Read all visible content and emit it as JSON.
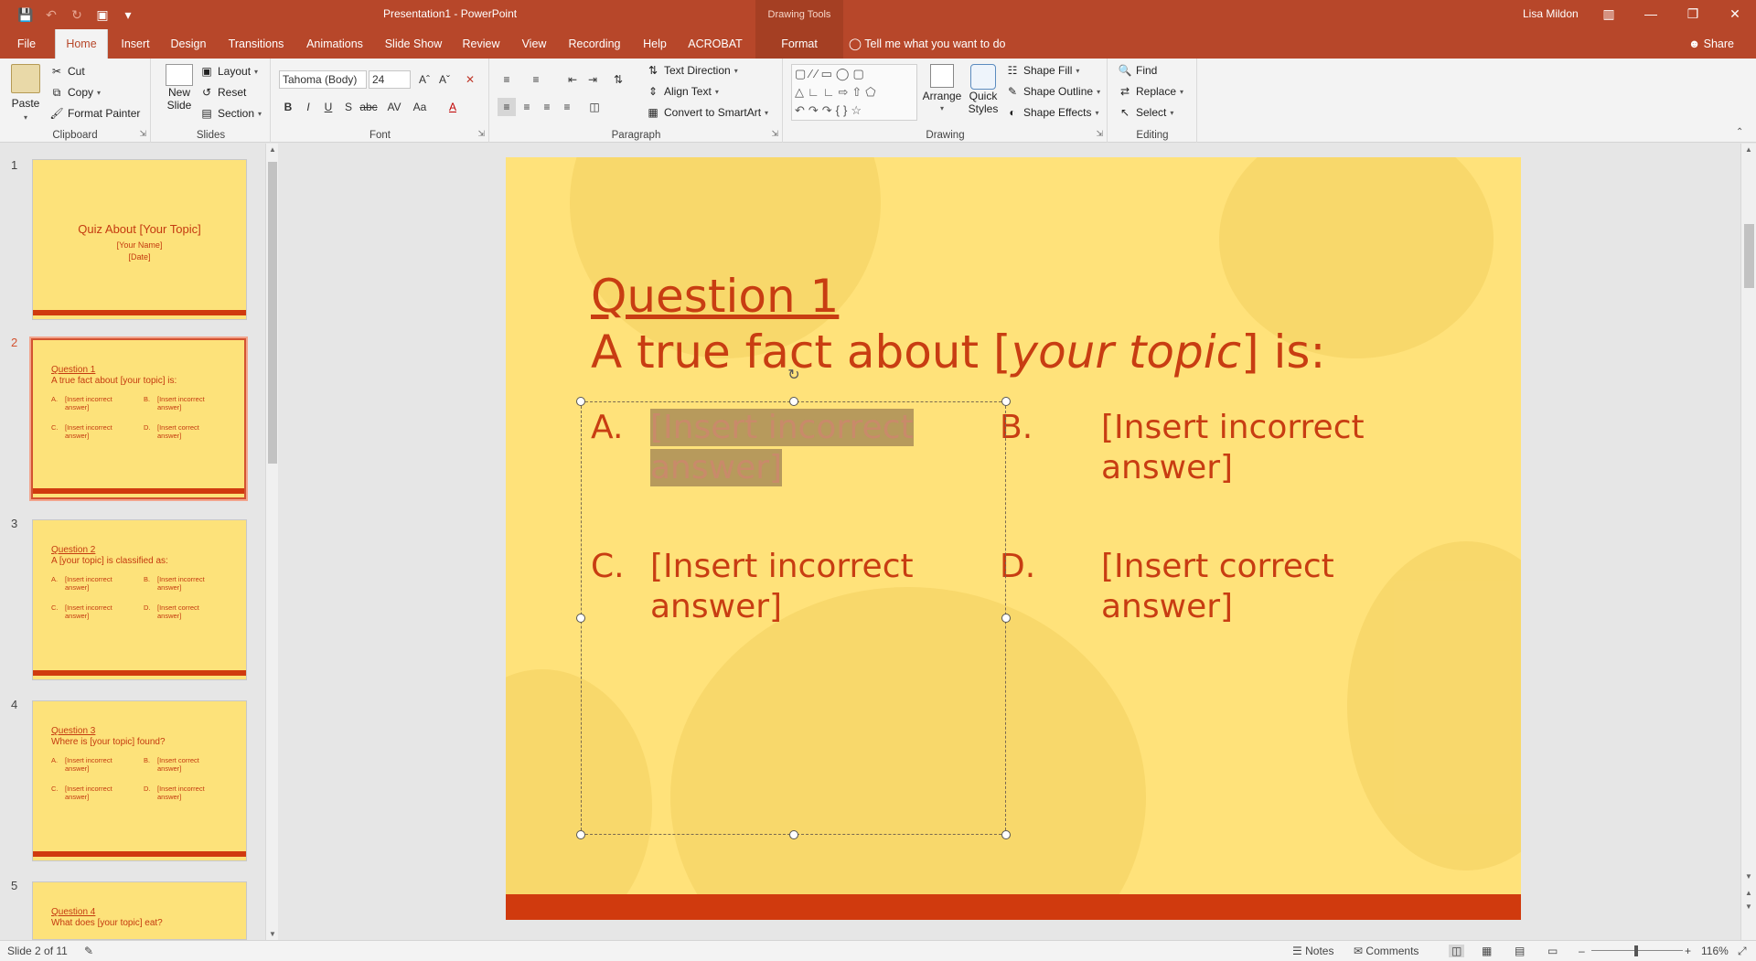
{
  "titlebar": {
    "doc_title": "Presentation1  -  PowerPoint",
    "context_title": "Drawing Tools",
    "user": "Lisa Mildon",
    "window_buttons": [
      "▥",
      "—",
      "❐",
      "✕"
    ]
  },
  "tabs": [
    "File",
    "Home",
    "Insert",
    "Design",
    "Transitions",
    "Animations",
    "Slide Show",
    "Review",
    "View",
    "Recording",
    "Help",
    "ACROBAT",
    "Format"
  ],
  "active_tab": "Home",
  "tell_me": "Tell me what you want to do",
  "share": "Share",
  "ribbon": {
    "clipboard": {
      "paste": "Paste",
      "cut": "Cut",
      "copy": "Copy",
      "format_painter": "Format Painter",
      "label": "Clipboard"
    },
    "slides": {
      "new_slide_1": "New",
      "new_slide_2": "Slide",
      "layout": "Layout",
      "reset": "Reset",
      "section": "Section",
      "label": "Slides"
    },
    "font": {
      "font_name": "Tahoma (Body)",
      "font_size": "24",
      "label": "Font"
    },
    "paragraph": {
      "text_direction": "Text Direction",
      "align_text": "Align Text",
      "convert": "Convert to SmartArt",
      "label": "Paragraph"
    },
    "drawing": {
      "arrange": "Arrange",
      "quick_1": "Quick",
      "quick_2": "Styles",
      "shape_fill": "Shape Fill",
      "shape_outline": "Shape Outline",
      "shape_effects": "Shape Effects",
      "label": "Drawing"
    },
    "editing": {
      "find": "Find",
      "replace": "Replace",
      "select": "Select",
      "label": "Editing"
    }
  },
  "thumbnails": [
    {
      "num": "1",
      "title": "Quiz About [Your Topic]",
      "line1": "[Your Name]",
      "line2": "[Date]"
    },
    {
      "num": "2",
      "q": "Question 1",
      "prompt": "A true fact about [your topic] is:",
      "a": "[Insert incorrect answer]",
      "b": "[Insert incorrect answer]",
      "c": "[Insert incorrect answer]",
      "d": "[Insert correct answer]"
    },
    {
      "num": "3",
      "q": "Question 2",
      "prompt": "A [your topic] is classified as:",
      "a": "[Insert incorrect answer]",
      "b": "[Insert incorrect answer]",
      "c": "[Insert incorrect answer]",
      "d": "[Insert correct answer]"
    },
    {
      "num": "4",
      "q": "Question 3",
      "prompt": "Where is [your topic] found?",
      "a": "[Insert incorrect answer]",
      "b": "[Insert correct answer]",
      "c": "[Insert incorrect answer]",
      "d": "[Insert incorrect answer]"
    },
    {
      "num": "5",
      "q": "Question 4",
      "prompt": "What does [your topic] eat?"
    }
  ],
  "slide": {
    "question": "Question 1",
    "prompt_pre": "A true fact about [",
    "prompt_em": "your topic",
    "prompt_post": "] is:",
    "options": [
      {
        "letter": "A.",
        "text_1": "[Insert incorrect",
        "text_2": "answer]"
      },
      {
        "letter": "B.",
        "text_1": "[Insert incorrect",
        "text_2": "answer]"
      },
      {
        "letter": "C.",
        "text_1": "[Insert incorrect",
        "text_2": "answer]"
      },
      {
        "letter": "D.",
        "text_1": "[Insert correct",
        "text_2": "answer]"
      }
    ]
  },
  "status": {
    "slide_count": "Slide 2 of 11",
    "notes": "Notes",
    "comments": "Comments",
    "zoom": "116%"
  },
  "colors": {
    "accent": "#b7472a",
    "slide_bg": "#ffe27a",
    "slide_text": "#c83d12",
    "slide_footer": "#d03a0e"
  }
}
